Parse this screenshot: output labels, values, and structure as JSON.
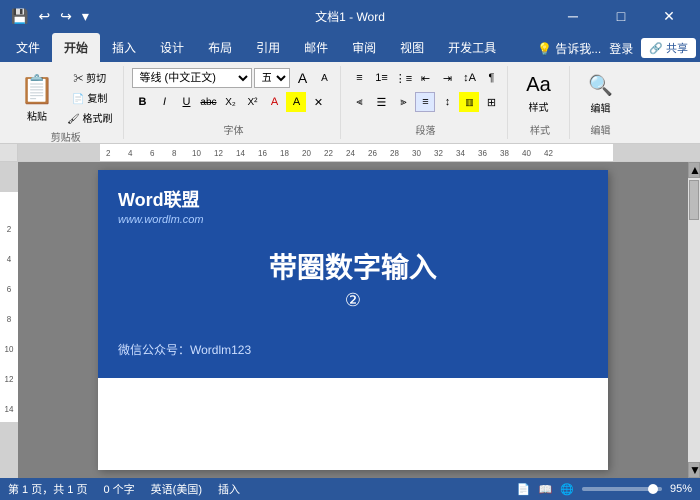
{
  "titleBar": {
    "title": "文档1 - Word",
    "minimizeLabel": "─",
    "restoreLabel": "□",
    "closeLabel": "✕"
  },
  "quickAccess": {
    "save": "💾",
    "undo": "↩",
    "redo": "↪",
    "more": "▾"
  },
  "ribbonTabs": {
    "tabs": [
      "文件",
      "开始",
      "插入",
      "设计",
      "布局",
      "引用",
      "邮件",
      "审阅",
      "视图",
      "开发工具"
    ],
    "activeTab": "开始",
    "rightItems": [
      "💡 告诉我...",
      "登录",
      "🔗 共享"
    ]
  },
  "ribbon": {
    "clipboard": {
      "label": "剪贴板",
      "pasteLabel": "粘贴",
      "cutLabel": "剪切",
      "copyLabel": "复制",
      "formatPainterLabel": "格式刷"
    },
    "font": {
      "label": "字体",
      "fontName": "等线 (中文正文)",
      "fontSize": "五号",
      "boldLabel": "B",
      "italicLabel": "I",
      "underlineLabel": "U",
      "strikeLabel": "abc",
      "subLabel": "X₂",
      "supLabel": "X²"
    },
    "paragraph": {
      "label": "段落"
    },
    "styles": {
      "label": "样式",
      "stylesBtn": "样式"
    },
    "editing": {
      "label": "编辑",
      "editBtn": "编辑"
    }
  },
  "document": {
    "banner": {
      "logo": "Word联盟",
      "url": "www.wordlm.com",
      "title": "带圈数字输入",
      "circleNum": "②",
      "footer": "微信公众号：Wordlm123"
    }
  },
  "statusBar": {
    "page": "第 1 页，共 1 页",
    "words": "0 个字",
    "language": "英语(美国)",
    "insertMode": "插入",
    "zoom": "95%"
  }
}
